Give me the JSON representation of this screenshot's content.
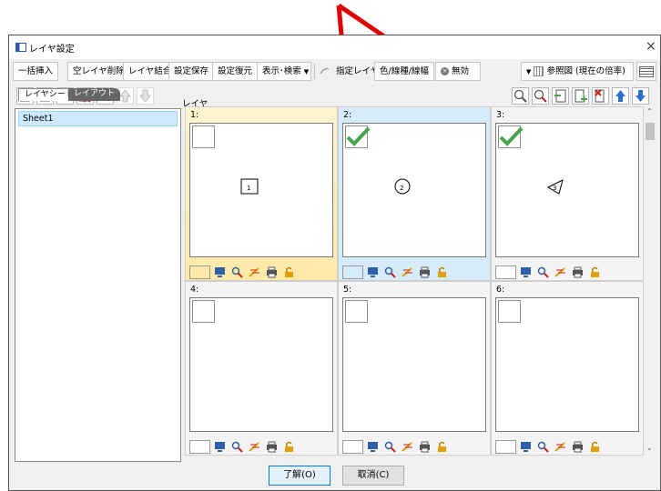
{
  "window": {
    "title": "レイヤ設定",
    "close": "×"
  },
  "toolbar": {
    "batch_insert": "一括挿入",
    "delete_empty": "空レイヤ削除",
    "merge_layers": "レイヤ結合",
    "save_settings": "設定保存",
    "restore_settings": "設定復元",
    "display_search": "表示･検索",
    "specified_layer": "指定レイヤ",
    "color_line": "色/線種/線幅",
    "invalid": "無効",
    "reference_view": "参照図 (現在の倍率)"
  },
  "sidebar": {
    "tabs": [
      "レイヤシート",
      "レイアウト"
    ],
    "items": [
      "Sheet1"
    ]
  },
  "panel": {
    "label": "レイヤ"
  },
  "layers": [
    {
      "label": "1:",
      "active": true,
      "checked": false,
      "symbol": "1",
      "shape": "square"
    },
    {
      "label": "2:",
      "active": false,
      "checked": true,
      "symbol": "2",
      "shape": "circle"
    },
    {
      "label": "3:",
      "active": false,
      "checked": true,
      "symbol": "3",
      "shape": "triangle"
    },
    {
      "label": "4:",
      "active": false,
      "checked": false,
      "symbol": "",
      "shape": "none"
    },
    {
      "label": "5:",
      "active": false,
      "checked": false,
      "symbol": "",
      "shape": "none"
    },
    {
      "label": "6:",
      "active": false,
      "checked": false,
      "symbol": "",
      "shape": "none"
    }
  ],
  "status_icons": [
    "monitor-icon",
    "search-person-icon",
    "highlighter-icon",
    "printer-icon",
    "lock-icon"
  ],
  "buttons": {
    "ok": "了解(O)",
    "cancel": "取消(C)"
  },
  "colors": {
    "active_layer": "#ffe9a8",
    "selected_layer": "#d6ecfa",
    "annotation_arrow": "#e00000",
    "check": "#4aa24a"
  }
}
